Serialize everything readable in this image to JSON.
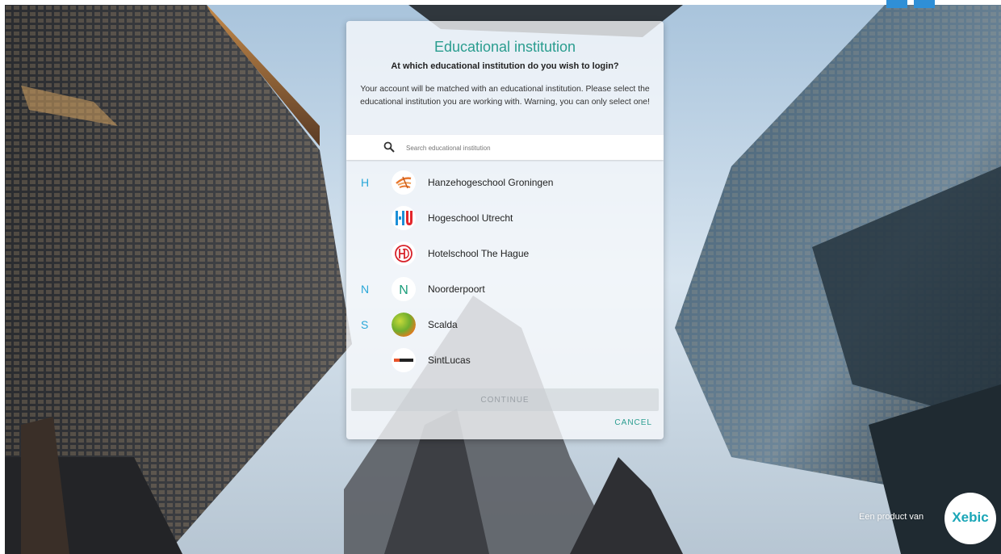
{
  "dialog": {
    "title": "Educational institution",
    "question": "At which educational institution do you wish to login?",
    "body": "Your account will be matched with an educational institution. Please select the educational institution you are working with. Warning, you can only select one!",
    "search": {
      "placeholder": "Search educational institution",
      "value": "",
      "icon": "search-icon"
    },
    "institutions": [
      {
        "letter": "H",
        "name": "Hanzehogeschool Groningen",
        "logo": "hanze-logo"
      },
      {
        "letter": "",
        "name": "Hogeschool Utrecht",
        "logo": "hu-logo"
      },
      {
        "letter": "",
        "name": "Hotelschool The Hague",
        "logo": "hotelschool-logo"
      },
      {
        "letter": "N",
        "name": "Noorderpoort",
        "logo": "noorderpoort-logo"
      },
      {
        "letter": "S",
        "name": "Scalda",
        "logo": "scalda-logo"
      },
      {
        "letter": "",
        "name": "SintLucas",
        "logo": "sintlucas-logo"
      }
    ],
    "continue_label": "CONTINUE",
    "cancel_label": "CANCEL"
  },
  "footer": {
    "product_text": "Een product van",
    "brand": "Xebic"
  },
  "colors": {
    "accent": "#2a9d8f",
    "index_letter": "#2aa7d8",
    "brand": "#1aa6b7"
  }
}
